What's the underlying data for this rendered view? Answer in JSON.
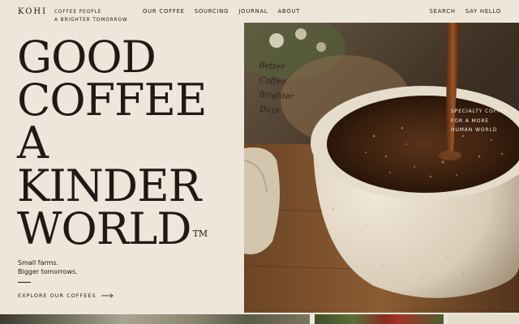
{
  "brand": {
    "logo": "KOHI",
    "tagline": [
      "COFFEE PEOPLE",
      "A BRIGHTER TOMORROW"
    ]
  },
  "nav": {
    "items": [
      "OUR COFFEE",
      "SOURCING",
      "JOURNAL",
      "ABOUT"
    ],
    "right": [
      "SEARCH",
      "SAY HELLO"
    ]
  },
  "hero": {
    "headline": [
      "GOOD",
      "COFFEE",
      "A",
      "KINDER",
      "WORLD"
    ],
    "trademark": "TM",
    "subline": [
      "Small farms.",
      "Bigger tomorrows."
    ],
    "cta": "EXPLORE OUR COFFEES",
    "script": [
      "Better",
      "Coffee",
      "Brighter",
      "Days"
    ],
    "overlay": [
      "SPECIALTY COFFEE",
      "FOR A MORE",
      "HUMAN WORLD"
    ]
  },
  "colors": {
    "background": "#ede6da",
    "ink": "#1f1a15",
    "coffee": "#3a1f0e",
    "cup": "#e2d7c6"
  },
  "icons": {
    "cta_arrow": "arrow-right-icon"
  }
}
